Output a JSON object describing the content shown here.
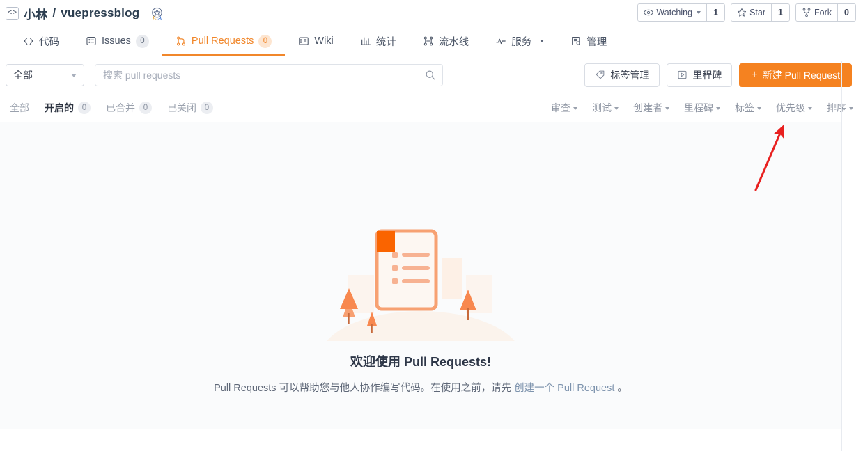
{
  "header": {
    "code_icon": "code-brackets-icon",
    "owner": "小林",
    "separator": "/",
    "repo": "vuepressblog",
    "badge_icon": "award-badge-icon",
    "watching_label": "Watching",
    "watching_count": "1",
    "star_label": "Star",
    "star_count": "1",
    "fork_label": "Fork",
    "fork_count": "0"
  },
  "nav": {
    "tabs": [
      {
        "label": "代码",
        "icon": "code-icon",
        "count": null,
        "active": false
      },
      {
        "label": "Issues",
        "icon": "issues-icon",
        "count": "0",
        "active": false
      },
      {
        "label": "Pull Requests",
        "icon": "pull-request-icon",
        "count": "0",
        "active": true
      },
      {
        "label": "Wiki",
        "icon": "wiki-book-icon",
        "count": null,
        "active": false
      },
      {
        "label": "统计",
        "icon": "chart-bar-icon",
        "count": null,
        "active": false
      },
      {
        "label": "流水线",
        "icon": "pipeline-icon",
        "count": null,
        "active": false
      },
      {
        "label": "服务",
        "icon": "service-pulse-icon",
        "count": null,
        "active": false,
        "caret": true
      },
      {
        "label": "管理",
        "icon": "manage-icon",
        "count": null,
        "active": false
      }
    ]
  },
  "search": {
    "scope_label": "全部",
    "placeholder": "搜索 pull requests",
    "value": "",
    "search_icon": "search-icon",
    "label_manage": "标签管理",
    "label_manage_icon": "tag-icon",
    "milestone": "里程碑",
    "milestone_icon": "milestone-icon",
    "new_pr": "新建 Pull Request",
    "new_pr_plus": "+"
  },
  "filters": {
    "states": [
      {
        "label": "全部",
        "count": null,
        "active": false
      },
      {
        "label": "开启的",
        "count": "0",
        "active": true
      },
      {
        "label": "已合并",
        "count": "0",
        "active": false
      },
      {
        "label": "已关闭",
        "count": "0",
        "active": false
      }
    ],
    "dropdowns": [
      {
        "label": "审查"
      },
      {
        "label": "测试"
      },
      {
        "label": "创建者"
      },
      {
        "label": "里程碑"
      },
      {
        "label": "标签"
      },
      {
        "label": "优先级"
      },
      {
        "label": "排序"
      }
    ]
  },
  "empty": {
    "illustration_icon": "empty-document-illustration",
    "title": "欢迎使用 Pull Requests!",
    "desc_prefix": "Pull Requests 可以帮助您与他人协作编写代码。在使用之前，请先 ",
    "desc_link": "创建一个 Pull Request",
    "desc_suffix": " 。"
  },
  "annotation": {
    "arrow_icon": "red-arrow-annotation",
    "color": "#e8201f"
  },
  "colors": {
    "accent": "#f58220",
    "tab_active": "#f1872b",
    "text": "#3b4351",
    "muted": "#9aa1ad",
    "content_bg": "#fafbfc",
    "link": "#7d93ad"
  }
}
